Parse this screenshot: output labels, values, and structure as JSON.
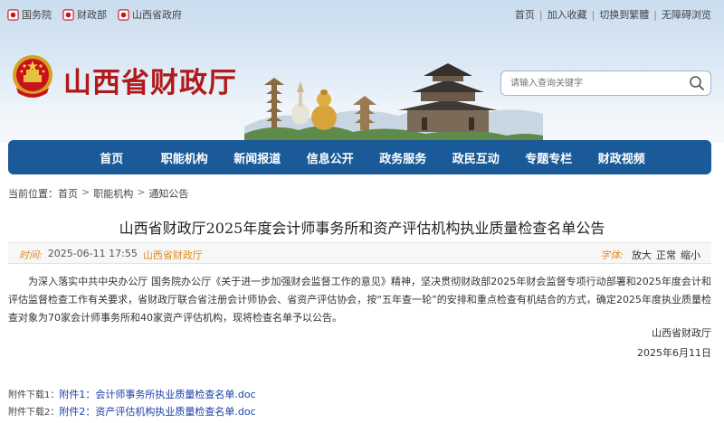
{
  "topbar": {
    "left_links": [
      {
        "label": "国务院",
        "icon": "flag-icon"
      },
      {
        "label": "财政部",
        "icon": "flag-icon"
      },
      {
        "label": "山西省政府",
        "icon": "flag-icon"
      }
    ],
    "right_links": [
      "首页",
      "加入收藏",
      "切换到繁體",
      "无障碍浏览"
    ]
  },
  "site": {
    "title": "山西省财政厅",
    "emblem": "national-emblem-icon",
    "accent_color": "#b01a1a"
  },
  "search": {
    "placeholder": "请输入查询关键字",
    "icon": "search-icon"
  },
  "nav": {
    "items": [
      "首页",
      "职能机构",
      "新闻报道",
      "信息公开",
      "政务服务",
      "政民互动",
      "专题专栏",
      "财政视频"
    ],
    "color": "#1a5a98"
  },
  "breadcrumb": {
    "label": "当前位置：",
    "items": [
      "首页",
      "职能机构",
      "通知公告"
    ],
    "separator": ">"
  },
  "article": {
    "title": "山西省财政厅2025年度会计师事务所和资产评估机构执业质量检查名单公告",
    "meta": {
      "time_label": "时间:",
      "time": "2025-06-11 17:55",
      "source": "山西省财政厅",
      "font_label": "字体:",
      "font_sizes": [
        "放大",
        "正常",
        "缩小"
      ]
    },
    "body": "为深入落实中共中央办公厅 国务院办公厅《关于进一步加强财会监督工作的意见》精神，坚决贯彻财政部2025年财会监督专项行动部署和2025年度会计和评估监督检查工作有关要求，省财政厅联合省注册会计师协会、省资产评估协会，按“五年查一轮”的安排和重点检查有机结合的方式，确定2025年度执业质量检查对象为70家会计师事务所和40家资产评估机构，现将检查名单予以公告。",
    "signature": "山西省财政厅",
    "date": "2025年6月11日"
  },
  "attachments": [
    {
      "label": "附件下载1：",
      "link": "附件1：会计师事务所执业质量检查名单.doc"
    },
    {
      "label": "附件下载2：",
      "link": "附件2：资产评估机构执业质量检查名单.doc"
    }
  ]
}
